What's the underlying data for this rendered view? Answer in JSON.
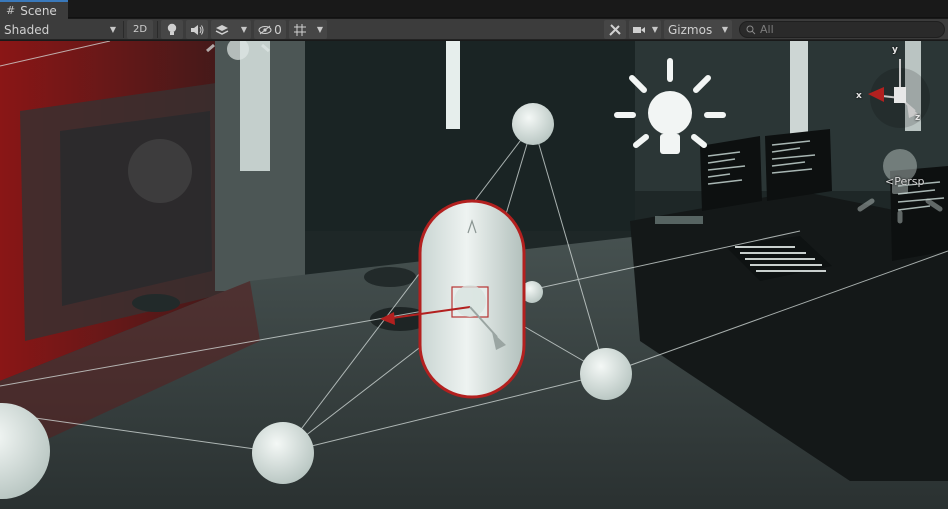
{
  "tab": {
    "label": "Scene",
    "icon": "scene-grid-icon"
  },
  "toolbar": {
    "draw_mode": "Shaded",
    "mode_2d": "2D",
    "lighting_icon": "lightbulb-icon",
    "audio_icon": "speaker-icon",
    "effects_icon": "layers-icon",
    "hidden_count": "0",
    "grid_icon": "grid-snap-icon",
    "tools_icon": "tools-icon",
    "camera_icon": "camera-icon",
    "gizmos_label": "Gizmos",
    "search_placeholder": "All"
  },
  "orientation_gizmo": {
    "x_label": "x",
    "y_label": "y",
    "z_label": "z",
    "projection": "Persp"
  },
  "colors": {
    "selection_outline": "#b3201f",
    "tab_accent": "#3a79bb",
    "toolbar_bg": "#3c3c3c"
  }
}
